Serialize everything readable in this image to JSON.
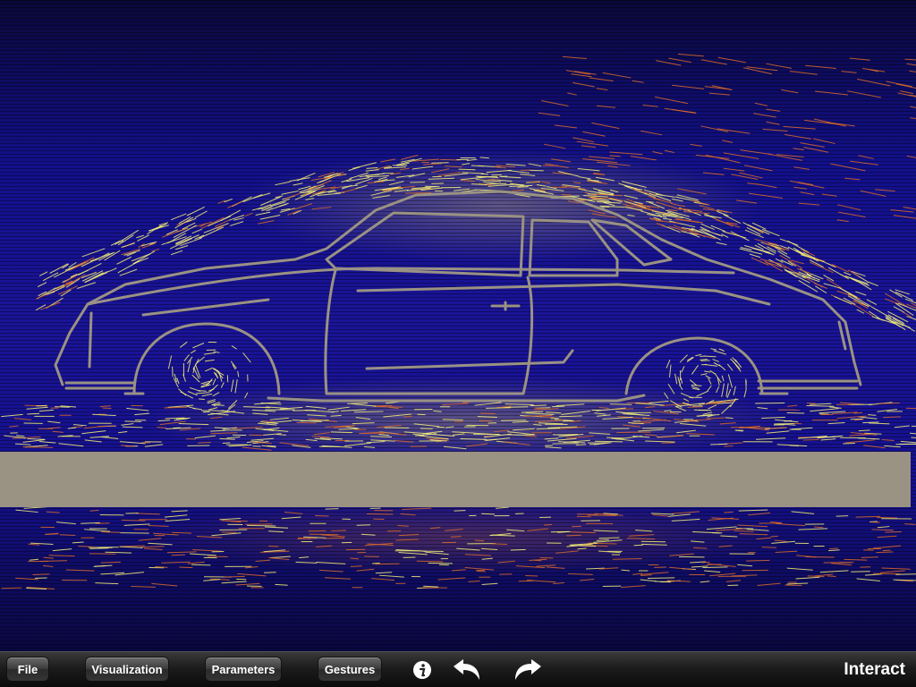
{
  "toolbar": {
    "file_label": "File",
    "visualization_label": "Visualization",
    "parameters_label": "Parameters",
    "gestures_label": "Gestures",
    "info_icon": "info-icon",
    "undo_icon": "undo-arrow-icon",
    "redo_icon": "redo-arrow-icon",
    "mode_label": "Interact"
  },
  "colors": {
    "flow_background": "#1a1498",
    "streak_high": "#f4f07a",
    "streak_mid": "#d96a2a",
    "car_outline": "#9a9283",
    "road": "#9a9283"
  }
}
